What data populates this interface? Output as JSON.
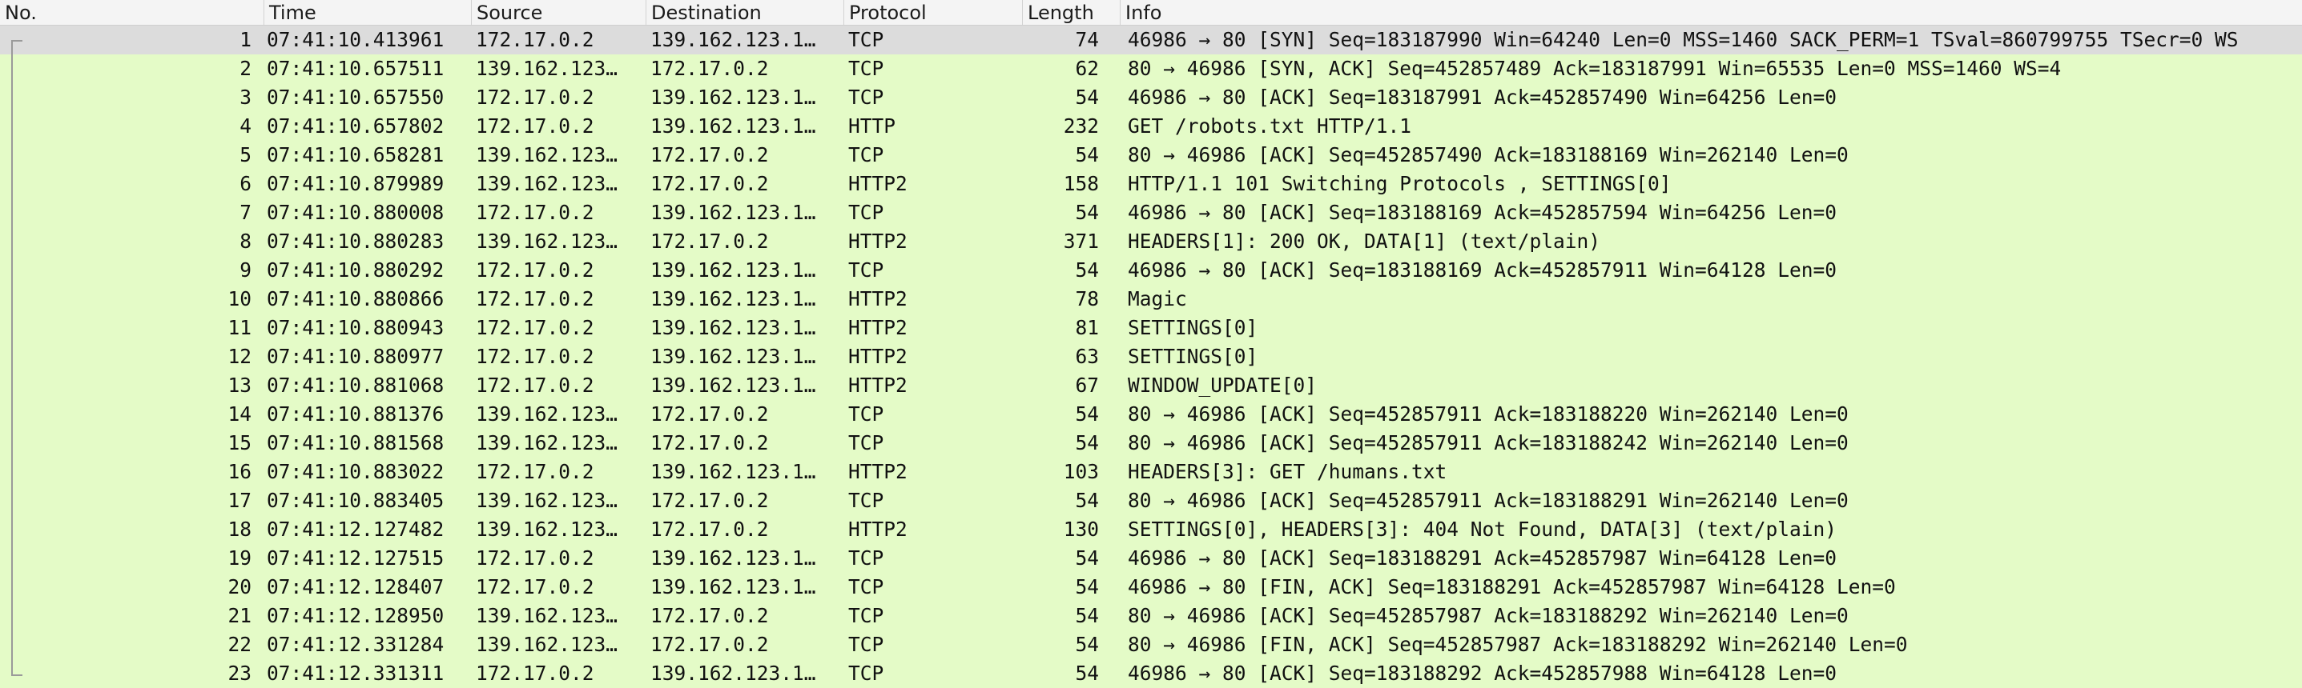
{
  "columns": {
    "no": "No.",
    "time": "Time",
    "source": "Source",
    "destination": "Destination",
    "protocol": "Protocol",
    "length": "Length",
    "info": "Info"
  },
  "colors": {
    "row_background": "#e4fbc7",
    "selected_row": "#dcdcdc",
    "header_background": "#f4f4f4"
  },
  "packets": [
    {
      "no": "1",
      "time": "07:41:10.413961",
      "source": "172.17.0.2",
      "destination": "139.162.123.1…",
      "protocol": "TCP",
      "length": "74",
      "info": "46986 → 80 [SYN] Seq=183187990 Win=64240 Len=0 MSS=1460 SACK_PERM=1 TSval=860799755 TSecr=0 WS",
      "selected": true
    },
    {
      "no": "2",
      "time": "07:41:10.657511",
      "source": "139.162.123…",
      "destination": "172.17.0.2",
      "protocol": "TCP",
      "length": "62",
      "info": "80 → 46986 [SYN, ACK] Seq=452857489 Ack=183187991 Win=65535 Len=0 MSS=1460 WS=4"
    },
    {
      "no": "3",
      "time": "07:41:10.657550",
      "source": "172.17.0.2",
      "destination": "139.162.123.1…",
      "protocol": "TCP",
      "length": "54",
      "info": "46986 → 80 [ACK] Seq=183187991 Ack=452857490 Win=64256 Len=0"
    },
    {
      "no": "4",
      "time": "07:41:10.657802",
      "source": "172.17.0.2",
      "destination": "139.162.123.1…",
      "protocol": "HTTP",
      "length": "232",
      "info": "GET /robots.txt HTTP/1.1"
    },
    {
      "no": "5",
      "time": "07:41:10.658281",
      "source": "139.162.123…",
      "destination": "172.17.0.2",
      "protocol": "TCP",
      "length": "54",
      "info": "80 → 46986 [ACK] Seq=452857490 Ack=183188169 Win=262140 Len=0"
    },
    {
      "no": "6",
      "time": "07:41:10.879989",
      "source": "139.162.123…",
      "destination": "172.17.0.2",
      "protocol": "HTTP2",
      "length": "158",
      "info": "HTTP/1.1 101 Switching Protocols , SETTINGS[0]"
    },
    {
      "no": "7",
      "time": "07:41:10.880008",
      "source": "172.17.0.2",
      "destination": "139.162.123.1…",
      "protocol": "TCP",
      "length": "54",
      "info": "46986 → 80 [ACK] Seq=183188169 Ack=452857594 Win=64256 Len=0"
    },
    {
      "no": "8",
      "time": "07:41:10.880283",
      "source": "139.162.123…",
      "destination": "172.17.0.2",
      "protocol": "HTTP2",
      "length": "371",
      "info": "HEADERS[1]: 200 OK, DATA[1] (text/plain)"
    },
    {
      "no": "9",
      "time": "07:41:10.880292",
      "source": "172.17.0.2",
      "destination": "139.162.123.1…",
      "protocol": "TCP",
      "length": "54",
      "info": "46986 → 80 [ACK] Seq=183188169 Ack=452857911 Win=64128 Len=0"
    },
    {
      "no": "10",
      "time": "07:41:10.880866",
      "source": "172.17.0.2",
      "destination": "139.162.123.1…",
      "protocol": "HTTP2",
      "length": "78",
      "info": "Magic"
    },
    {
      "no": "11",
      "time": "07:41:10.880943",
      "source": "172.17.0.2",
      "destination": "139.162.123.1…",
      "protocol": "HTTP2",
      "length": "81",
      "info": "SETTINGS[0]"
    },
    {
      "no": "12",
      "time": "07:41:10.880977",
      "source": "172.17.0.2",
      "destination": "139.162.123.1…",
      "protocol": "HTTP2",
      "length": "63",
      "info": "SETTINGS[0]"
    },
    {
      "no": "13",
      "time": "07:41:10.881068",
      "source": "172.17.0.2",
      "destination": "139.162.123.1…",
      "protocol": "HTTP2",
      "length": "67",
      "info": "WINDOW_UPDATE[0]"
    },
    {
      "no": "14",
      "time": "07:41:10.881376",
      "source": "139.162.123…",
      "destination": "172.17.0.2",
      "protocol": "TCP",
      "length": "54",
      "info": "80 → 46986 [ACK] Seq=452857911 Ack=183188220 Win=262140 Len=0"
    },
    {
      "no": "15",
      "time": "07:41:10.881568",
      "source": "139.162.123…",
      "destination": "172.17.0.2",
      "protocol": "TCP",
      "length": "54",
      "info": "80 → 46986 [ACK] Seq=452857911 Ack=183188242 Win=262140 Len=0"
    },
    {
      "no": "16",
      "time": "07:41:10.883022",
      "source": "172.17.0.2",
      "destination": "139.162.123.1…",
      "protocol": "HTTP2",
      "length": "103",
      "info": "HEADERS[3]: GET /humans.txt"
    },
    {
      "no": "17",
      "time": "07:41:10.883405",
      "source": "139.162.123…",
      "destination": "172.17.0.2",
      "protocol": "TCP",
      "length": "54",
      "info": "80 → 46986 [ACK] Seq=452857911 Ack=183188291 Win=262140 Len=0"
    },
    {
      "no": "18",
      "time": "07:41:12.127482",
      "source": "139.162.123…",
      "destination": "172.17.0.2",
      "protocol": "HTTP2",
      "length": "130",
      "info": "SETTINGS[0], HEADERS[3]: 404 Not Found, DATA[3] (text/plain)"
    },
    {
      "no": "19",
      "time": "07:41:12.127515",
      "source": "172.17.0.2",
      "destination": "139.162.123.1…",
      "protocol": "TCP",
      "length": "54",
      "info": "46986 → 80 [ACK] Seq=183188291 Ack=452857987 Win=64128 Len=0"
    },
    {
      "no": "20",
      "time": "07:41:12.128407",
      "source": "172.17.0.2",
      "destination": "139.162.123.1…",
      "protocol": "TCP",
      "length": "54",
      "info": "46986 → 80 [FIN, ACK] Seq=183188291 Ack=452857987 Win=64128 Len=0"
    },
    {
      "no": "21",
      "time": "07:41:12.128950",
      "source": "139.162.123…",
      "destination": "172.17.0.2",
      "protocol": "TCP",
      "length": "54",
      "info": "80 → 46986 [ACK] Seq=452857987 Ack=183188292 Win=262140 Len=0"
    },
    {
      "no": "22",
      "time": "07:41:12.331284",
      "source": "139.162.123…",
      "destination": "172.17.0.2",
      "protocol": "TCP",
      "length": "54",
      "info": "80 → 46986 [FIN, ACK] Seq=452857987 Ack=183188292 Win=262140 Len=0"
    },
    {
      "no": "23",
      "time": "07:41:12.331311",
      "source": "172.17.0.2",
      "destination": "139.162.123.1…",
      "protocol": "TCP",
      "length": "54",
      "info": "46986 → 80 [ACK] Seq=183188292 Ack=452857988 Win=64128 Len=0"
    }
  ]
}
